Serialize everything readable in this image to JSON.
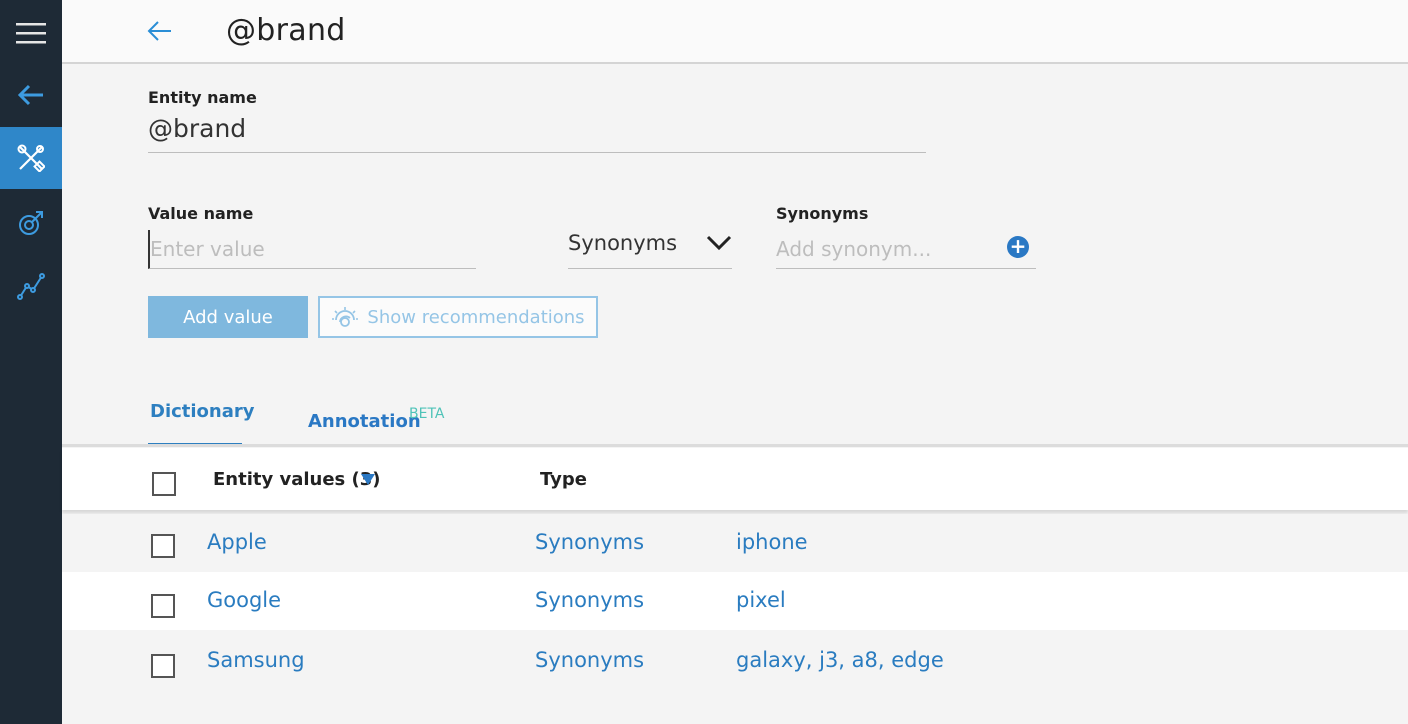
{
  "header": {
    "title": "@brand"
  },
  "sidebar": {
    "items": [
      {
        "icon": "hamburger-menu-icon"
      },
      {
        "icon": "back-arrow-icon"
      },
      {
        "icon": "tools-icon",
        "active": true
      },
      {
        "icon": "deploy-icon"
      },
      {
        "icon": "analytics-icon"
      }
    ]
  },
  "form": {
    "entity_name_label": "Entity name",
    "entity_name_value": "@brand",
    "value_name_label": "Value name",
    "value_name_placeholder": "Enter value",
    "type_select_value": "Synonyms",
    "synonyms_label": "Synonyms",
    "synonyms_placeholder": "Add synonym...",
    "add_value_label": "Add value",
    "show_recommendations_label": "Show recommendations"
  },
  "tabs": [
    {
      "label": "Dictionary",
      "active": true
    },
    {
      "label": "Annotation",
      "badge": "BETA"
    }
  ],
  "table": {
    "headers": [
      "Entity values (3)",
      "Type"
    ],
    "rows": [
      {
        "value": "Apple",
        "type": "Synonyms",
        "synonyms": "iphone"
      },
      {
        "value": "Google",
        "type": "Synonyms",
        "synonyms": "pixel"
      },
      {
        "value": "Samsung",
        "type": "Synonyms",
        "synonyms": "galaxy, j3, a8, edge"
      }
    ]
  },
  "colors": {
    "accent": "#2a78c4",
    "sidebar": "#1e2a36",
    "active_sidebar": "#2f87c9",
    "beta": "#4fc3b8"
  }
}
